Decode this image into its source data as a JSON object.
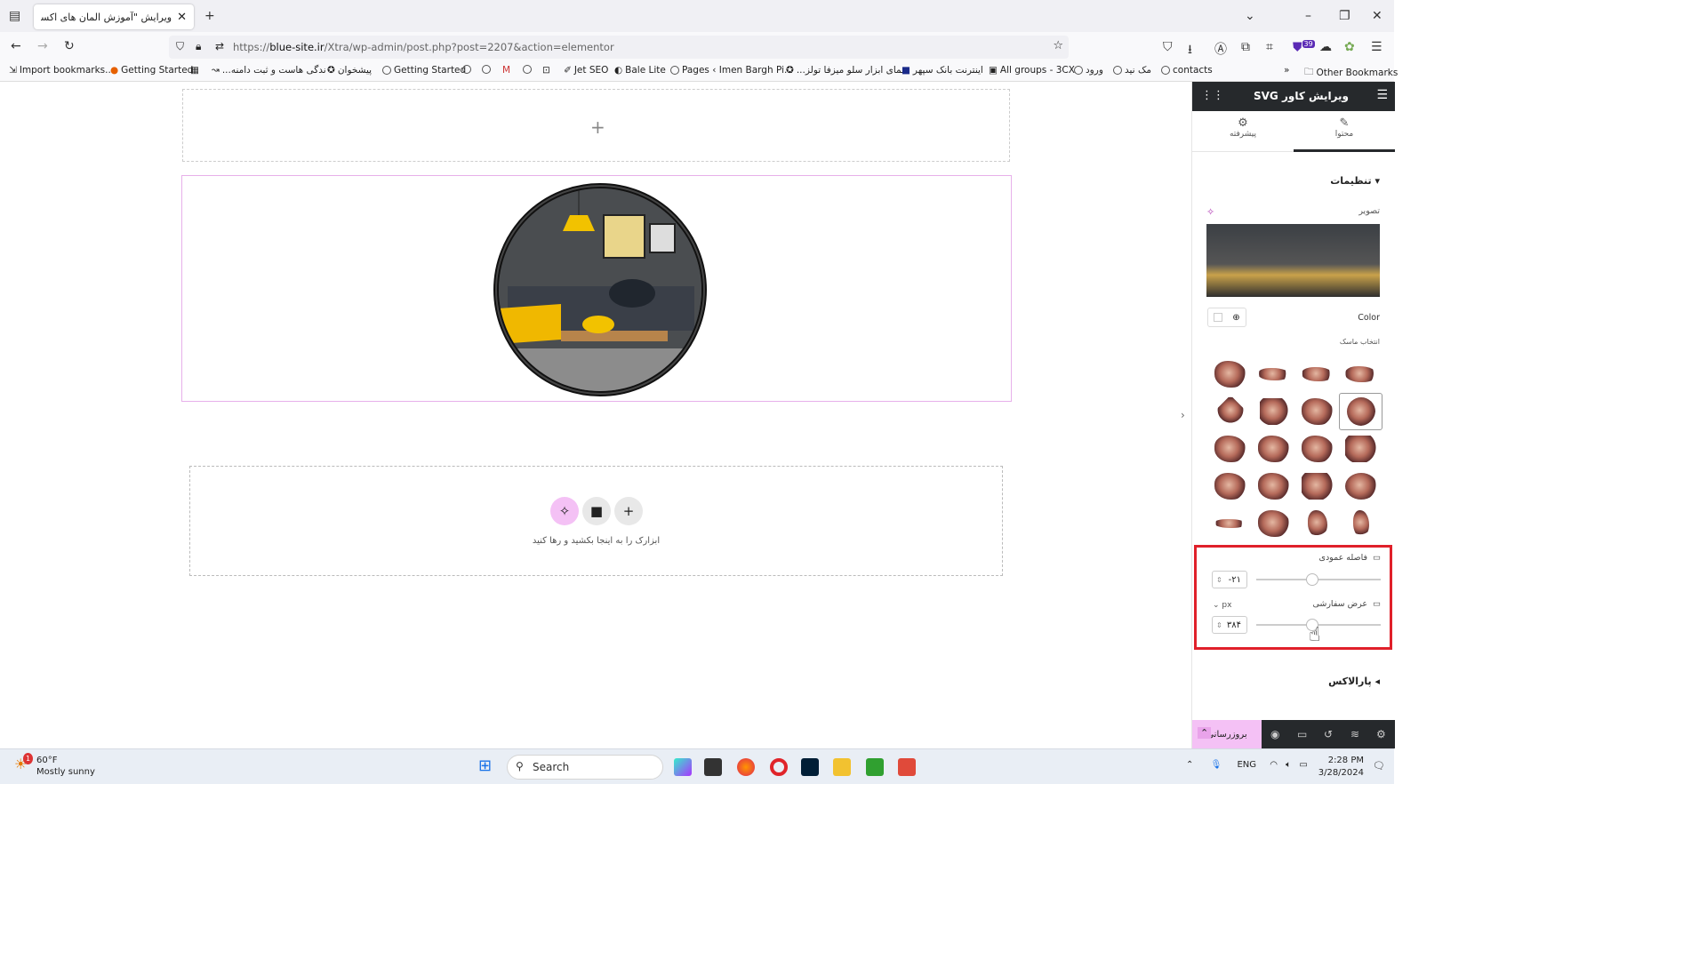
{
  "browser": {
    "tab_title": "ویرایش \"آموزش المان های اکسترا – ...\"",
    "url_prefix": "https://",
    "url_domain": "blue-site.ir",
    "url_path": "/Xtra/wp-admin/post.php?post=2207&action=elementor",
    "extension_badge": "39"
  },
  "bookmarks": [
    "Import bookmarks...",
    "Getting Started",
    "...ندگی هاست و ثبت دامنه",
    "پیشخوان",
    "Getting Started",
    "Jet SEO",
    "Bale Lite",
    "Pages ‹ Imen Bargh Pi...",
    "...نمای ابزار سلو میزفا تولز",
    "اینترنت بانک سپهر",
    "All groups - 3CX",
    "ورود",
    "مک نید",
    "contacts",
    "Other Bookmarks"
  ],
  "canvas": {
    "drop_text": "ابزارک را به اینجا بکشید و رها کنید"
  },
  "panel": {
    "title": "ویرایش کاور SVG",
    "tab_content": "محتوا",
    "tab_advanced": "پیشرفته",
    "section_settings": "تنظیمات",
    "image_label": "تصویر",
    "color_label": "Color",
    "mask_label": "انتخاب ماسک",
    "vertical_spacing_label": "فاصله عمودی",
    "vertical_spacing_value": "-۲۱",
    "custom_width_label": "عرض سفارشی",
    "custom_width_unit": "px",
    "custom_width_value": "۳۸۴",
    "section_parallax": "پارالاکس",
    "update_button": "بروزرسانی"
  },
  "taskbar": {
    "temperature": "60°F",
    "weather": "Mostly sunny",
    "weather_badge": "1",
    "search_placeholder": "Search",
    "language": "ENG",
    "time": "2:28 PM",
    "date": "3/28/2024"
  },
  "colors": {
    "accent_pink": "#f4c1f5",
    "panel_dark": "#26292c",
    "highlight_red": "#e0202a"
  }
}
